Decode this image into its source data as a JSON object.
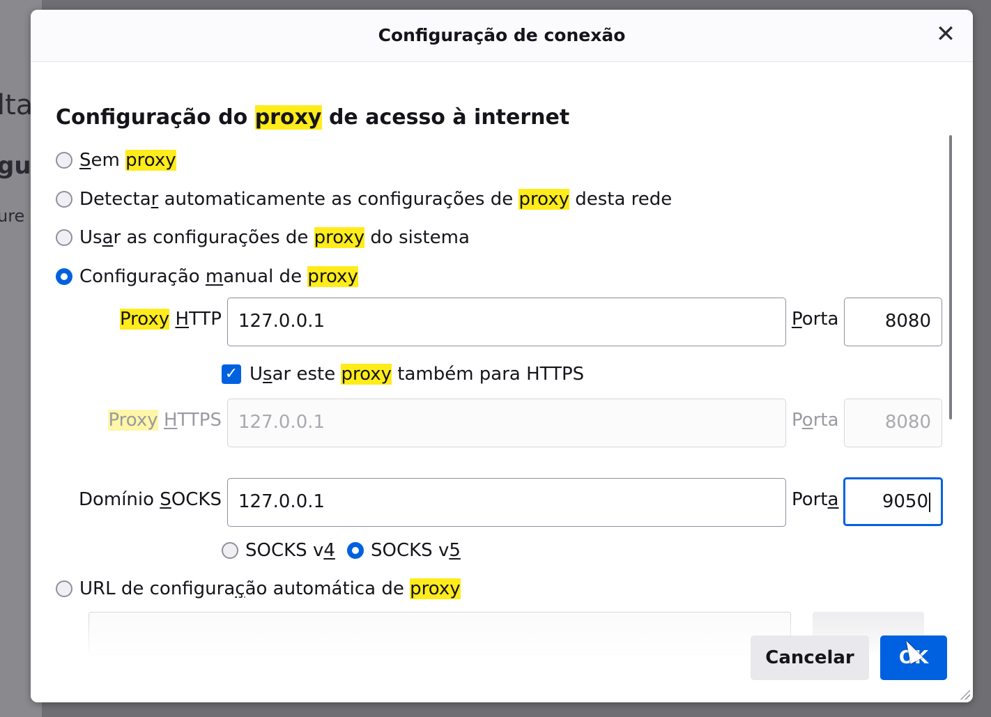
{
  "background": {
    "fragment_1": "lta",
    "fragment_2": "gu",
    "fragment_3": "ure"
  },
  "dialog": {
    "title": "Configuração de conexão",
    "close_icon": "close-icon"
  },
  "heading": {
    "before": "Configuração do ",
    "highlight": "proxy",
    "after": " de acesso à internet"
  },
  "options": {
    "no_proxy": {
      "a": "S",
      "b": "em ",
      "hl": "proxy",
      "c": ""
    },
    "auto_detect": {
      "a": "Detecta",
      "b": "r",
      "c": " automaticamente as configurações de ",
      "hl": "proxy",
      "d": " desta rede"
    },
    "system": {
      "a": "Us",
      "b": "a",
      "c": "r as configurações de ",
      "hl": "proxy",
      "d": " do sistema"
    },
    "manual": {
      "a": "Configuração ",
      "b": "m",
      "c": "anual de ",
      "hl": "proxy"
    },
    "pac_url": {
      "a": "URL de configura",
      "b": "ç",
      "c": "ão automática de ",
      "hl": "proxy"
    }
  },
  "http": {
    "label_hl": "Proxy",
    "label_u": "H",
    "label_rest": "TTP",
    "value": "127.0.0.1",
    "port_label_u": "P",
    "port_label_rest": "orta",
    "port": "8080"
  },
  "also_https": {
    "a": "U",
    "b": "s",
    "c": "ar este ",
    "hl": "proxy",
    "d": " também para HTTPS",
    "checked": true
  },
  "https": {
    "label_hl": "Proxy",
    "label_u": "H",
    "label_rest": "TTPS",
    "value": "127.0.0.1",
    "port_label_a": "P",
    "port_label_u": "o",
    "port_label_rest": "rta",
    "port": "8080"
  },
  "socks": {
    "label_a": "Domínio ",
    "label_u": "S",
    "label_rest": "OCKS",
    "value": "127.0.0.1",
    "port_label_a": "Port",
    "port_label_u": "a",
    "port": "9050",
    "v4_a": "SOCKS v",
    "v4_u": "4",
    "v5_a": "SOCKS v",
    "v5_u": "5",
    "selected": "v5"
  },
  "footer": {
    "cancel_label": "Cancelar",
    "ok_label": "OK"
  },
  "colors": {
    "accent": "#0061e0",
    "highlight": "#ffec1a"
  }
}
